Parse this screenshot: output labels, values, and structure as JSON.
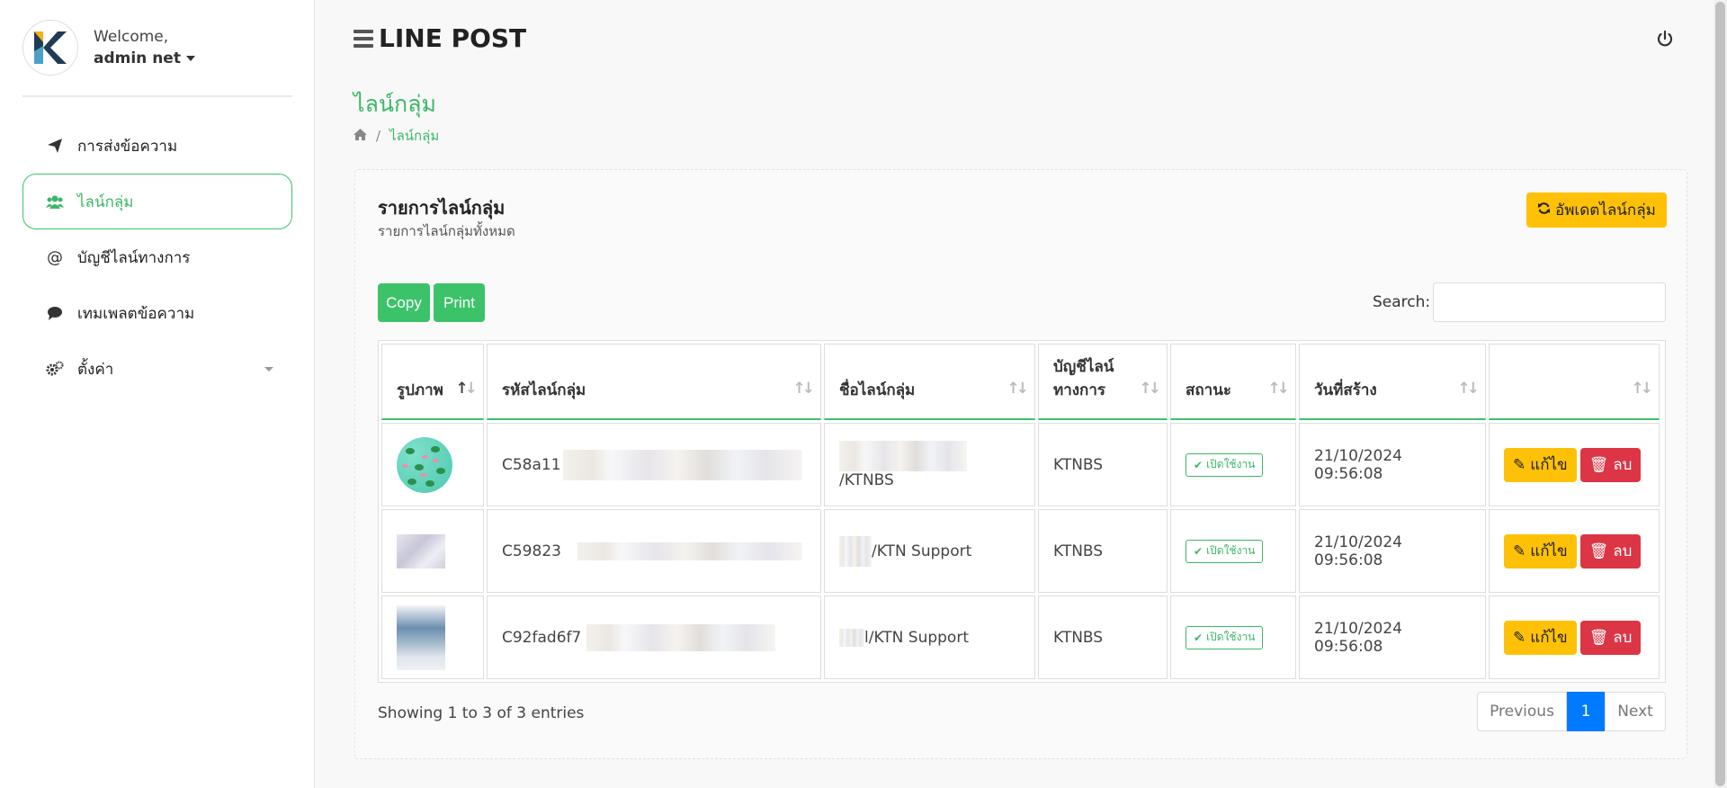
{
  "profile": {
    "welcome": "Welcome,",
    "username": "admin net"
  },
  "sidebar": {
    "items": [
      {
        "label": "การส่งข้อความ",
        "icon": "paper-plane-icon"
      },
      {
        "label": "ไลน์กลุ่ม",
        "icon": "users-icon",
        "active": true
      },
      {
        "label": "บัญชีไลน์ทางการ",
        "icon": "at-icon"
      },
      {
        "label": "เทมเพลตข้อความ",
        "icon": "comment-icon"
      },
      {
        "label": "ตั้งค่า",
        "icon": "gears-icon",
        "has_submenu": true
      }
    ]
  },
  "header": {
    "app_title": "LINE POST"
  },
  "page": {
    "title": "ไลน์กลุ่ม",
    "breadcrumb_current": "ไลน์กลุ่ม"
  },
  "card": {
    "title": "รายการไลน์กลุ่ม",
    "subtitle": "รายการไลน์กลุ่มทั้งหมด",
    "update_button": "อัพเดตไลน์กลุ่ม"
  },
  "toolbar": {
    "copy_label": "Copy",
    "print_label": "Print",
    "search_label": "Search:",
    "search_value": ""
  },
  "table": {
    "headers": [
      "รูปภาพ",
      "รหัสไลน์กลุ่ม",
      "ชื่อไลน์กลุ่ม",
      "บัญชีไลน์\nทางการ",
      "สถานะ",
      "วันที่สร้าง",
      ""
    ],
    "rows": [
      {
        "id": "C58a11",
        "name": "/KTNBS",
        "account": "KTNBS",
        "status": "เปิดใช้งาน",
        "created": "21/10/2024 09:56:08",
        "edit": "แก้ไข",
        "delete": "ลบ"
      },
      {
        "id": "C59823",
        "name": "/KTN Support",
        "account": "KTNBS",
        "status": "เปิดใช้งาน",
        "created": "21/10/2024 09:56:08",
        "edit": "แก้ไข",
        "delete": "ลบ"
      },
      {
        "id": "C92fad6f7",
        "name": "l/KTN Support",
        "account": "KTNBS",
        "status": "เปิดใช้งาน",
        "created": "21/10/2024 09:56:08",
        "edit": "แก้ไข",
        "delete": "ลบ"
      }
    ]
  },
  "footer": {
    "info": "Showing 1 to 3 of 3 entries",
    "prev": "Previous",
    "page": "1",
    "next": "Next"
  },
  "colors": {
    "accent": "#3cc36a",
    "warning": "#ffc107",
    "danger": "#dc3545",
    "primary": "#007bff"
  }
}
